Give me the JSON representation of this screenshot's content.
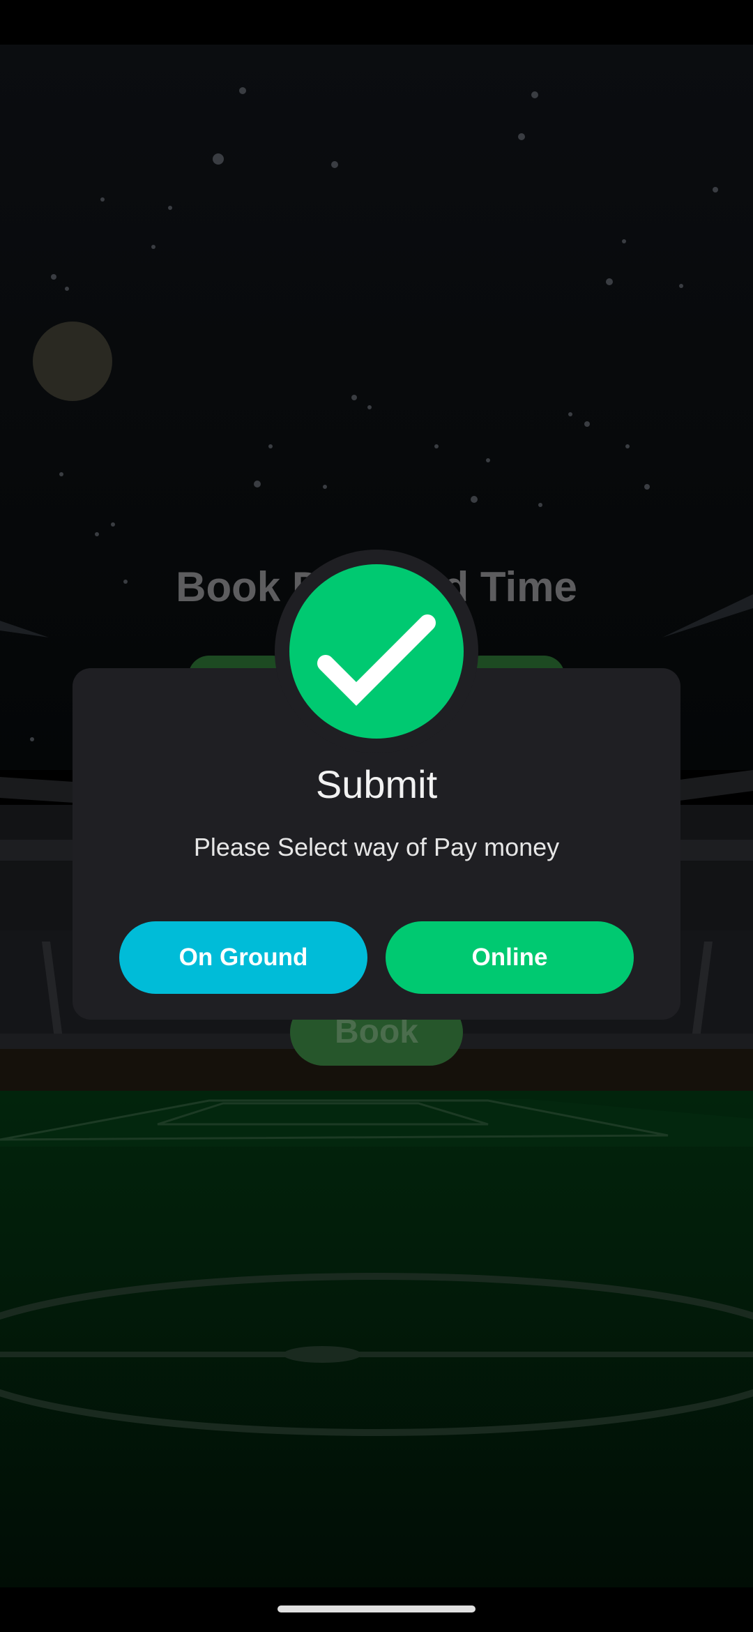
{
  "background": {
    "title": "Book Date and Time",
    "book_label": "Book"
  },
  "dialog": {
    "title": "Submit",
    "message": "Please Select way of Pay money",
    "buttons": {
      "on_ground": "On Ground",
      "online": "Online"
    }
  },
  "icons": {
    "success": "check-icon"
  },
  "colors": {
    "dialog_bg": "#1f1f23",
    "success_green": "#00c971",
    "on_ground_blue": "#00bcd8",
    "text_light": "#f2f2f2"
  }
}
